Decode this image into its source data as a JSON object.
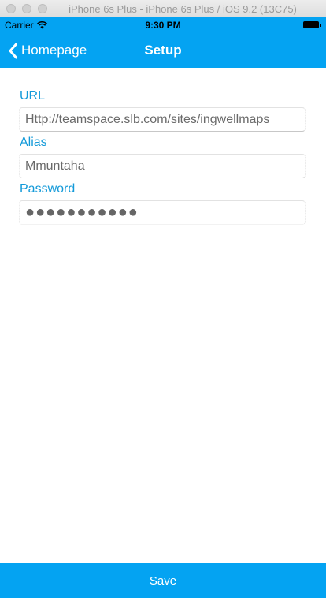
{
  "simulator": {
    "title": "iPhone 6s Plus - iPhone 6s Plus / iOS 9.2 (13C75)"
  },
  "status_bar": {
    "carrier": "Carrier",
    "time": "9:30 PM"
  },
  "nav": {
    "back_label": "Homepage",
    "title": "Setup"
  },
  "form": {
    "url_label": "URL",
    "url_value": "Http://teamspace.slb.com/sites/ingwellmaps",
    "alias_label": "Alias",
    "alias_value": "Mmuntaha",
    "password_label": "Password",
    "password_value": "●●●●●●●●●●●"
  },
  "footer": {
    "save_label": "Save"
  },
  "colors": {
    "accent": "#04a3f2",
    "label": "#139ad9"
  }
}
